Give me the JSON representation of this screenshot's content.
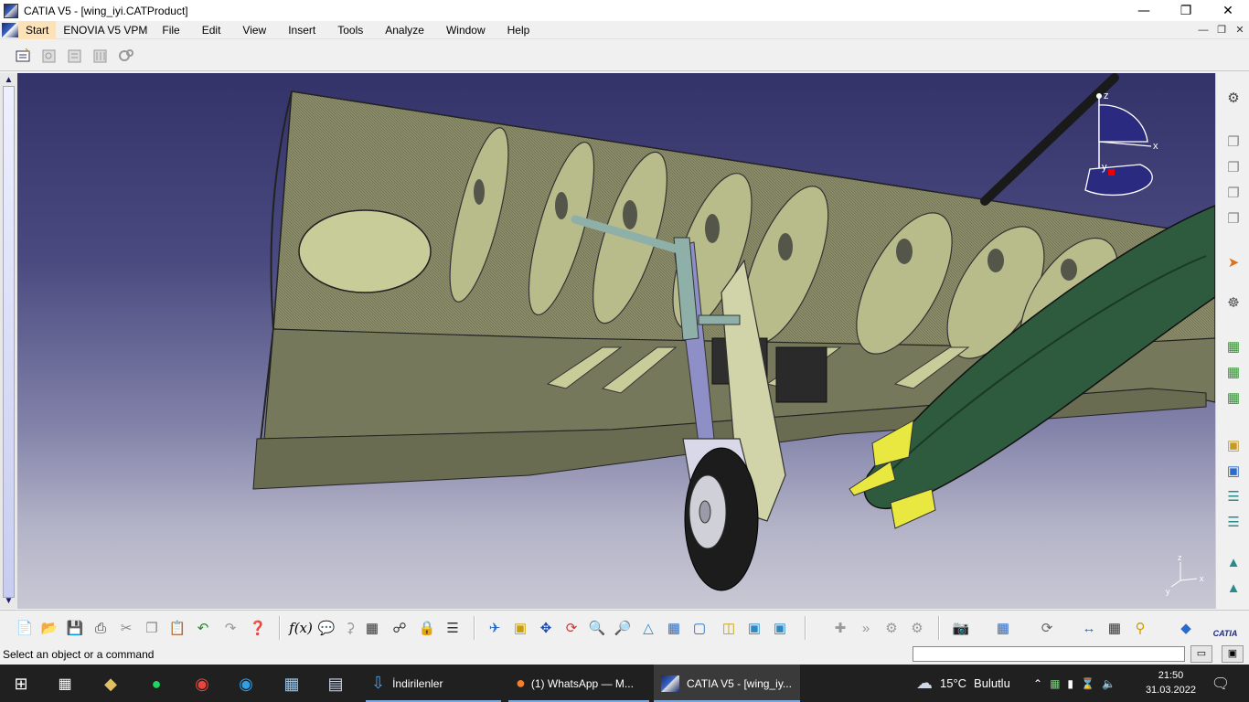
{
  "window": {
    "title": "CATIA V5 - [wing_iyi.CATProduct]",
    "minimize_glyph": "—",
    "maximize_glyph": "❐",
    "close_glyph": "✕"
  },
  "menubar": {
    "items": [
      "Start",
      "ENOVIA V5 VPM",
      "File",
      "Edit",
      "View",
      "Insert",
      "Tools",
      "Analyze",
      "Window",
      "Help"
    ],
    "active_item": "Start"
  },
  "top_toolbar": {
    "icons": [
      "product-structure-icon",
      "catalog-icon",
      "constraint-icon",
      "group-icon",
      "gears-icon"
    ]
  },
  "viewport": {
    "compass_labels": {
      "z": "z",
      "x": "x",
      "y": "y"
    },
    "mini_axis_labels": {
      "z": "z",
      "x": "x",
      "y": "y"
    },
    "colors": {
      "background_top": "#33336a",
      "background_bottom": "#c8c8d4",
      "wing_structure": "#b8bc8a",
      "fuel_tank": "#2e5a3e",
      "landing_gear_strut": "#8f8fc8",
      "wheel": "#222222",
      "fin": "#e8e840"
    }
  },
  "right_toolbar": {
    "icons": [
      "gear-icon",
      "copy-icon",
      "copy-icon",
      "copy-icon",
      "copy-icon",
      "select-cursor-icon",
      "move-icon",
      "insert-component-icon",
      "insert-product-icon",
      "insert-part-icon",
      "existing-component-icon",
      "assembly-icon",
      "tree-icon",
      "tree-icon",
      "snap-icon",
      "snap-icon"
    ]
  },
  "bottom_toolbar": {
    "icons": [
      "new-icon",
      "open-icon",
      "save-icon",
      "print-icon",
      "cut-icon",
      "copy-icon",
      "paste-icon",
      "undo-icon",
      "redo-icon",
      "whats-this-icon",
      "formula-icon",
      "comment-icon",
      "knowledge-icon",
      "table-icon",
      "tree-layout-icon",
      "lock-icon",
      "tree-expand-icon",
      "fly-mode-icon",
      "fit-all-icon",
      "pan-icon",
      "rotate-icon",
      "zoom-in-icon",
      "zoom-out-icon",
      "normal-view-icon",
      "multi-view-icon",
      "iso-view-icon",
      "shading-icon",
      "hide-show-icon",
      "swap-visible-icon",
      "snap-icon",
      "manipulate-icon",
      "constraint-icon",
      "measure-icon",
      "camera-icon",
      "catalog-icon",
      "update-icon",
      "measure-between-icon",
      "analysis-icon",
      "clash-icon",
      "catia-logo-icon"
    ],
    "catia_logo_text": "CATIA"
  },
  "statusbar": {
    "message": "Select an object or a command",
    "command_input_value": ""
  },
  "taskbar": {
    "tasks": [
      {
        "label": "İndirilenler"
      },
      {
        "label": "(1) WhatsApp — M..."
      },
      {
        "label": "CATIA V5 - [wing_iy..."
      }
    ],
    "weather_temp": "15°C",
    "weather_text": "Bulutlu",
    "time": "21:50",
    "date": "31.03.2022"
  }
}
